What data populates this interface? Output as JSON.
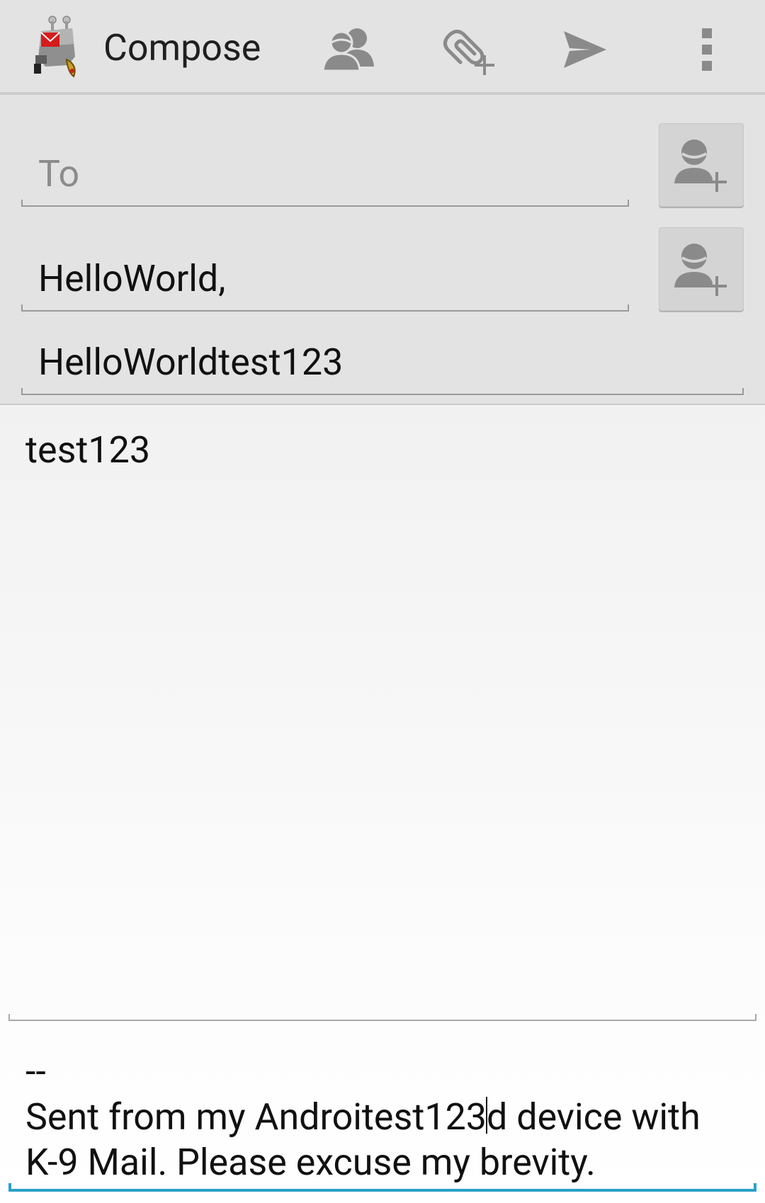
{
  "action_bar": {
    "title": "Compose",
    "icons": {
      "logo": "k9-mail-logo",
      "contacts": "contacts-icon",
      "attach": "attach-icon",
      "send": "send-icon",
      "overflow": "overflow-menu-icon"
    }
  },
  "recipients": {
    "to": {
      "placeholder": "To",
      "value": ""
    },
    "cc": {
      "value": "HelloWorld,"
    }
  },
  "subject": {
    "value": "HelloWorldtest123"
  },
  "message": {
    "body": "test123"
  },
  "signature": {
    "separator": "--",
    "text_before_cursor": "Sent from my Androitest123",
    "text_after_cursor": "d device with K-9 Mail. Please excuse my brevity."
  },
  "colors": {
    "action_bar_bg": "#e3e3e3",
    "focus_accent": "#2aa0c9",
    "icon_gray": "#8a8a8a"
  }
}
